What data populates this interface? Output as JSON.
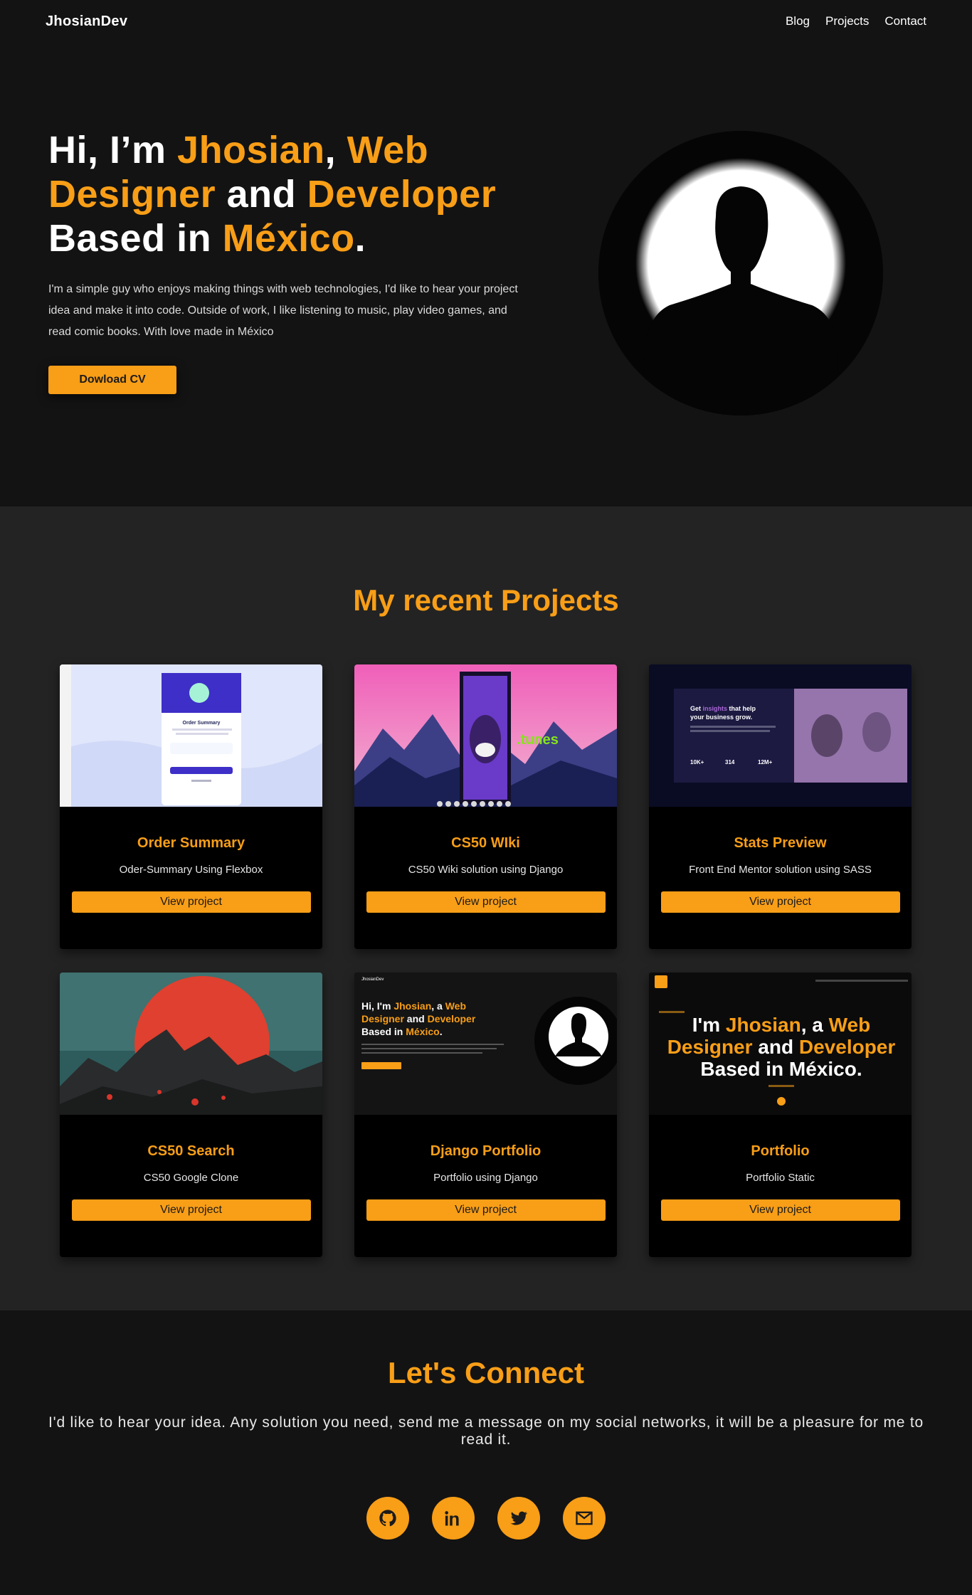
{
  "nav": {
    "brand": "JhosianDev",
    "links": [
      "Blog",
      "Projects",
      "Contact"
    ]
  },
  "hero": {
    "title": {
      "p1": "Hi, I’m ",
      "name": "Jhosian",
      "p2": ", ",
      "web": "Web",
      "designer": "Designer",
      "and": " and ",
      "developer": "Developer",
      "based": "Based in ",
      "mexico": "México",
      "dot": "."
    },
    "description": "I'm a simple guy who enjoys making things with web technologies, I'd like to hear your project idea and make it into code. Outside of work, I like listening to music, play video games, and read comic books. With love made in México",
    "cv_button": "Dowload CV"
  },
  "projects": {
    "title": "My recent Projects",
    "items": [
      {
        "title": "Order Summary",
        "description": "Oder-Summary Using Flexbox",
        "button": "View project",
        "thumb": "order-summary"
      },
      {
        "title": "CS50 WIki",
        "description": "CS50 Wiki solution using Django",
        "button": "View project",
        "thumb": "cs50-wiki"
      },
      {
        "title": "Stats Preview",
        "description": "Front End Mentor solution using SASS",
        "button": "View project",
        "thumb": "stats-preview"
      },
      {
        "title": "CS50 Search",
        "description": "CS50 Google Clone",
        "button": "View project",
        "thumb": "cs50-search"
      },
      {
        "title": "Django Portfolio",
        "description": "Portfolio using Django",
        "button": "View project",
        "thumb": "django-portfolio"
      },
      {
        "title": "Portfolio",
        "description": "Portfolio Static",
        "button": "View project",
        "thumb": "portfolio-static"
      }
    ]
  },
  "thumbs": {
    "order_summary": {
      "heading": "Order Summary"
    },
    "cs50_wiki": {
      "brand": ".tunes"
    },
    "stats": {
      "heading_a": "Get ",
      "heading_b": "insights",
      "heading_c": " that help",
      "heading_d": "your business grow.",
      "s1": "10K+",
      "s2": "314",
      "s3": "12M+"
    },
    "django": {
      "brand": "JhosianDev",
      "l1a": "Hi, I'm ",
      "l1b": "Jhosian",
      "l1c": ", a ",
      "l1d": "Web",
      "l2a": "Designer",
      "l2b": " and ",
      "l2c": "Developer",
      "l3a": "Based in ",
      "l3b": "México",
      "l3c": "."
    },
    "static": {
      "l1a": "I'm ",
      "l1b": "Jhosian",
      "l1c": ", a ",
      "l1d": "Web",
      "l2a": "Designer",
      "l2b": " and ",
      "l2c": "Developer",
      "l3": "Based in México."
    }
  },
  "connect": {
    "title": "Let's Connect",
    "text": "I'd like to hear your idea. Any solution you need, send me a message on my social networks, it will be a pleasure for me to read it.",
    "socials": [
      "github-icon",
      "linkedin-icon",
      "twitter-icon",
      "mail-icon"
    ]
  },
  "colors": {
    "accent": "#f89e17",
    "background": "#131313",
    "section": "#232323"
  }
}
